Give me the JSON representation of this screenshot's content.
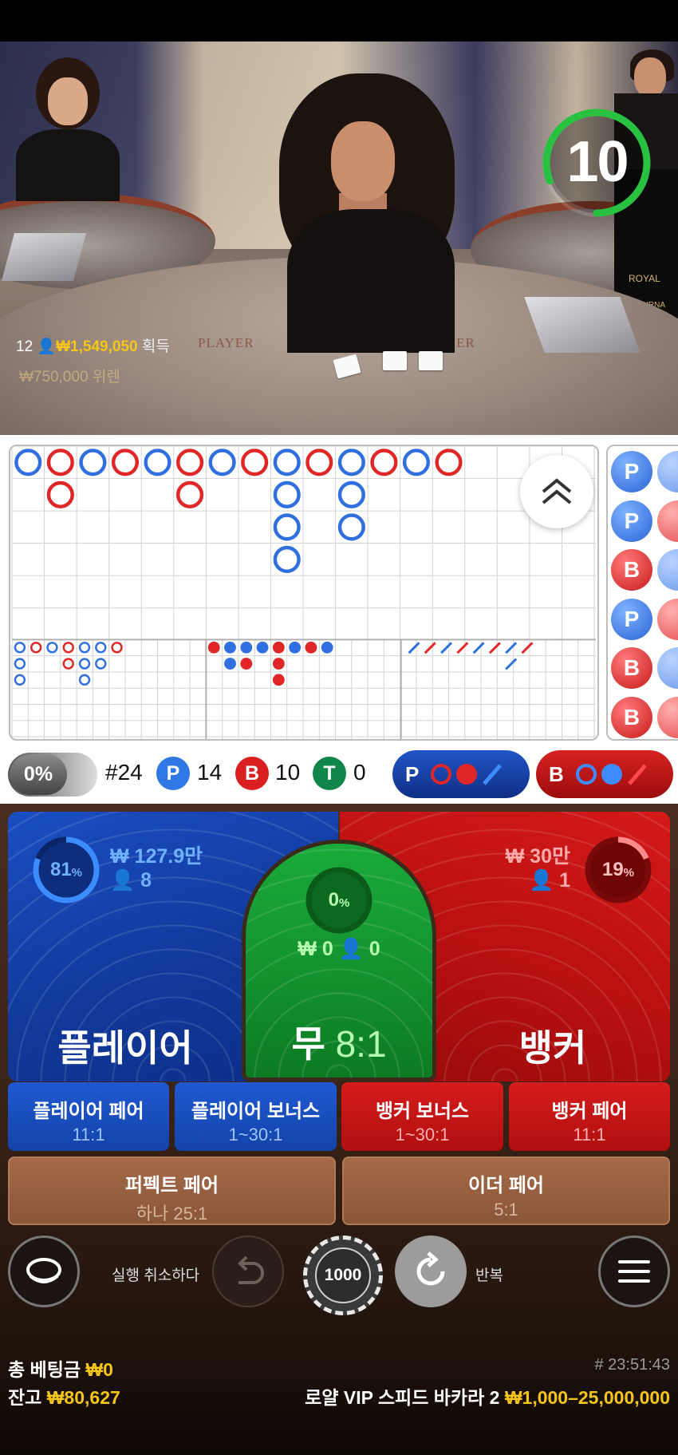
{
  "video": {
    "timer": "10",
    "win_count": "12",
    "win_amount": "₩1,549,050",
    "win_label": "획득",
    "faded_text": "₩750,000 위렌",
    "felt_player": "PLAYER",
    "felt_banker": "BANKER",
    "banner_text": "ROYAL",
    "banner_text2": "TOURNA"
  },
  "roadmap": {
    "side_beads": [
      "P",
      "P",
      "B",
      "P",
      "B",
      "B"
    ],
    "colors": {
      "player": "#2f6fe0",
      "banker": "#e02626",
      "tie": "#12924a"
    }
  },
  "stats": {
    "percent": "0%",
    "round": "#24",
    "player_letter": "P",
    "player_count": "14",
    "banker_letter": "B",
    "banker_count": "10",
    "tie_letter": "T",
    "tie_count": "0",
    "predict_player": "P",
    "predict_banker": "B"
  },
  "bets": {
    "player": {
      "percent": "81",
      "pct_sign": "%",
      "amount": "₩ 127.9만",
      "players": "8",
      "title": "플레이어"
    },
    "banker": {
      "percent": "19",
      "pct_sign": "%",
      "amount": "₩ 30만",
      "players": "1",
      "title": "뱅커"
    },
    "tie": {
      "percent": "0",
      "pct_sign": "%",
      "amount": "₩ 0",
      "players": "0",
      "title": "무",
      "odds": "8:1"
    },
    "side": [
      {
        "name": "플레이어 페어",
        "odds": "11:1"
      },
      {
        "name": "플레이어 보너스",
        "odds": "1~30:1"
      },
      {
        "name": "뱅커 보너스",
        "odds": "1~30:1"
      },
      {
        "name": "뱅커 페어",
        "odds": "11:1"
      }
    ],
    "pairs": [
      {
        "name": "퍼펙트 페어",
        "odds": "하나 25:1"
      },
      {
        "name": "이더 페어",
        "odds": "5:1"
      }
    ]
  },
  "controls": {
    "undo_label": "실행 취소하다",
    "chip_value": "1000",
    "repeat_label": "반복"
  },
  "footer": {
    "total_bet_label": "총 베팅금",
    "total_bet_value": "₩0",
    "balance_label": "잔고",
    "balance_value": "₩80,627",
    "round_id": "# 23:51:43",
    "table_name": "로얄 VIP 스피드 바카라 2",
    "limits": "₩1,000–25,000,000"
  }
}
